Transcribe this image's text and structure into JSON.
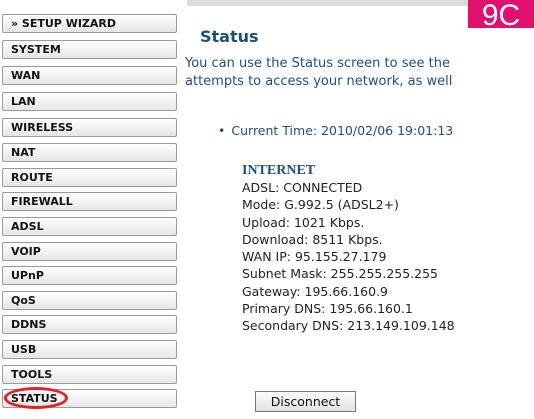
{
  "sidebar": {
    "items": [
      {
        "label": "» SETUP WIZARD"
      },
      {
        "label": "SYSTEM"
      },
      {
        "label": "WAN"
      },
      {
        "label": "LAN"
      },
      {
        "label": "WIRELESS"
      },
      {
        "label": "NAT"
      },
      {
        "label": "ROUTE"
      },
      {
        "label": "FIREWALL"
      },
      {
        "label": "ADSL"
      },
      {
        "label": "VOIP"
      },
      {
        "label": "UPnP"
      },
      {
        "label": "QoS"
      },
      {
        "label": "DDNS"
      },
      {
        "label": "USB"
      },
      {
        "label": "TOOLS"
      },
      {
        "label": "STATUS"
      }
    ],
    "active": "STATUS"
  },
  "badge": {
    "text": "9C",
    "color": "#e0116e"
  },
  "main": {
    "title": "Status",
    "intro_line1": "You can use the Status screen to see the",
    "intro_line2": "attempts to access your network, as well",
    "current_time": "Current Time: 2010/02/06 19:01:13",
    "internet": {
      "heading": "INTERNET",
      "rows": [
        "ADSL:  CONNECTED",
        "Mode:  G.992.5 (ADSL2+)",
        "Upload:  1021 Kbps.",
        "Download:  8511 Kbps.",
        "WAN IP:  95.155.27.179",
        "Subnet Mask:  255.255.255.255",
        "Gateway:  195.66.160.9",
        "Primary DNS:  195.66.160.1",
        "Secondary DNS:  213.149.109.148"
      ]
    },
    "disconnect_label": "Disconnect"
  },
  "annotation": {
    "color": "#e2202a"
  }
}
